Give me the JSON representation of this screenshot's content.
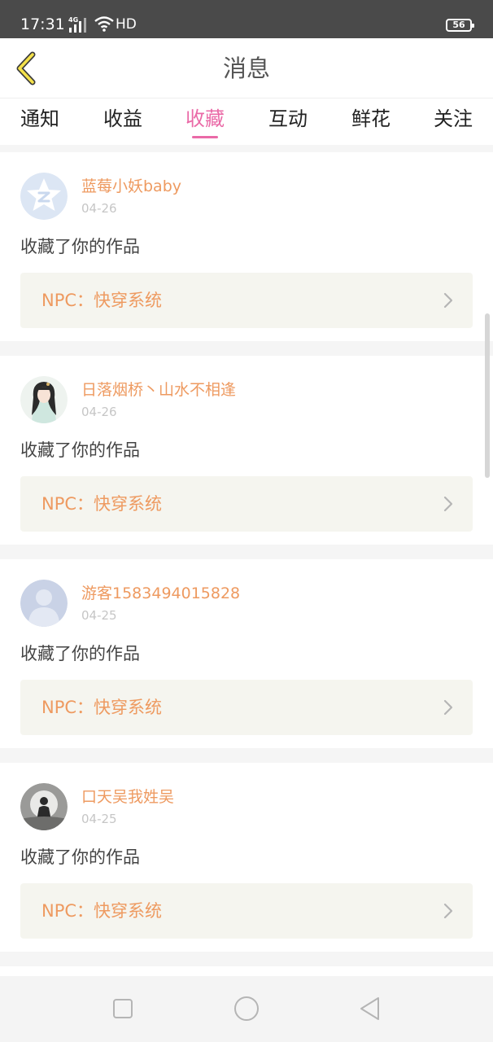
{
  "status_bar": {
    "time": "17:31",
    "network": "4G",
    "hd": "HD",
    "battery": "56"
  },
  "header": {
    "title": "消息",
    "back_icon": "chevron-left-icon",
    "accent_color": "#f4e14b"
  },
  "tabs": [
    {
      "label": "通知",
      "active": false
    },
    {
      "label": "收益",
      "active": false
    },
    {
      "label": "收藏",
      "active": true
    },
    {
      "label": "互动",
      "active": false
    },
    {
      "label": "鲜花",
      "active": false
    },
    {
      "label": "关注",
      "active": false
    }
  ],
  "colors": {
    "active_tab": "#ea6aa7",
    "username": "#ee9a60",
    "date": "#c6c6c6",
    "work_box": "#f5f5ef"
  },
  "messages": [
    {
      "username": "蓝莓小妖baby",
      "date": "04-26",
      "text": "收藏了你的作品",
      "work": "NPC：快穿系统",
      "avatar": "q-logo-avatar"
    },
    {
      "username": "日落烟桥丶山水不相逢",
      "date": "04-26",
      "text": "收藏了你的作品",
      "work": "NPC：快穿系统",
      "avatar": "illustrated-girl-avatar"
    },
    {
      "username": "游客1583494015828",
      "date": "04-25",
      "text": "收藏了你的作品",
      "work": "NPC：快穿系统",
      "avatar": "default-user-avatar"
    },
    {
      "username": "口天吴我姓吴",
      "date": "04-25",
      "text": "收藏了你的作品",
      "work": "NPC：快穿系统",
      "avatar": "photo-person-avatar"
    }
  ],
  "nav_bar": {
    "buttons": [
      "recent-apps-icon",
      "home-icon",
      "back-triangle-icon"
    ]
  }
}
